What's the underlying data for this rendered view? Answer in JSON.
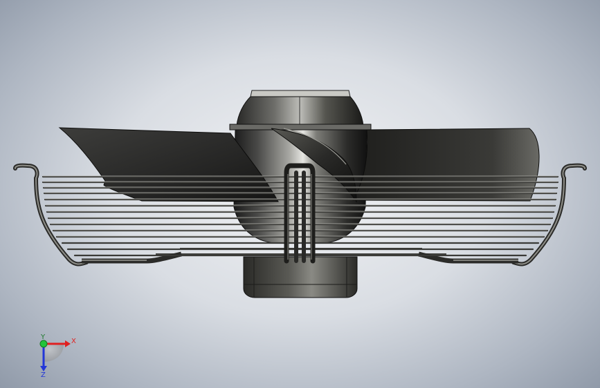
{
  "viewport": {
    "model_name": "axial-fan-with-guard",
    "background_top": "#f2f3f5",
    "background_edge": "#8f99a8"
  },
  "triad": {
    "x_label": "X",
    "y_label": "Y",
    "z_label": "Z",
    "x_color": "#e02020",
    "y_color": "#22c33a",
    "z_color": "#2236d8"
  }
}
